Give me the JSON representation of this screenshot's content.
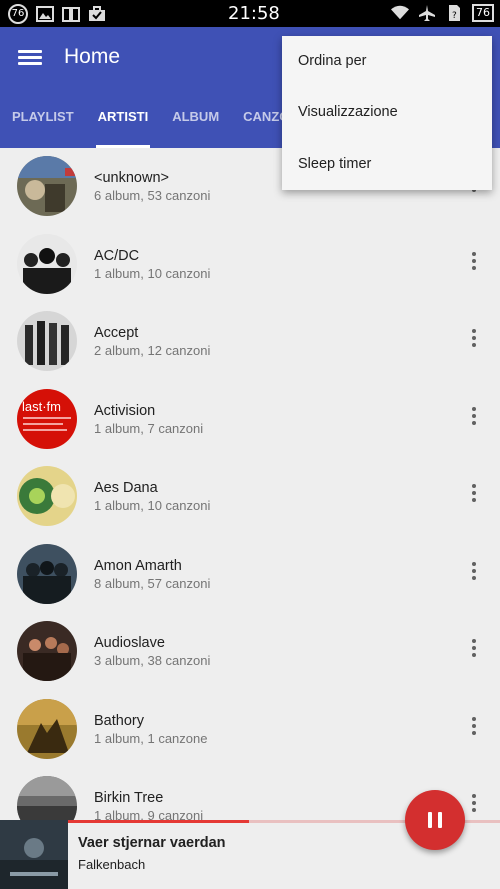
{
  "status_bar": {
    "notification_badge": "76",
    "time": "21:58",
    "battery": "76",
    "icons": [
      "image-icon",
      "book-icon",
      "briefcase-icon",
      "wifi-icon",
      "airplane-icon",
      "sim-icon",
      "battery-icon"
    ]
  },
  "app_bar": {
    "title": "Home",
    "color": "#3f51b5",
    "tabs": [
      {
        "label": "PLAYLIST"
      },
      {
        "label": "ARTISTI"
      },
      {
        "label": "ALBUM"
      },
      {
        "label": "CANZONI"
      }
    ],
    "active_tab": "ARTISTI"
  },
  "overflow_menu": {
    "items": [
      {
        "label": "Ordina per"
      },
      {
        "label": "Visualizzazione"
      },
      {
        "label": "Sleep timer"
      }
    ]
  },
  "artists": [
    {
      "name": "<unknown>",
      "meta": "6 album, 53 canzoni"
    },
    {
      "name": "AC/DC",
      "meta": "1 album, 10 canzoni"
    },
    {
      "name": "Accept",
      "meta": "2 album, 12 canzoni"
    },
    {
      "name": "Activision",
      "meta": "1 album, 7 canzoni",
      "avatar_text": "last·fm"
    },
    {
      "name": "Aes Dana",
      "meta": "1 album, 10 canzoni"
    },
    {
      "name": "Amon Amarth",
      "meta": "8 album, 57 canzoni"
    },
    {
      "name": "Audioslave",
      "meta": "3 album, 38 canzoni"
    },
    {
      "name": "Bathory",
      "meta": "1 album, 1 canzone"
    },
    {
      "name": "Birkin Tree",
      "meta": "1 album, 9 canzoni"
    }
  ],
  "player": {
    "title": "Vaer stjernar vaerdan",
    "artist": "Falkenbach",
    "progress": 0.42,
    "accent": "#d32f2f"
  }
}
